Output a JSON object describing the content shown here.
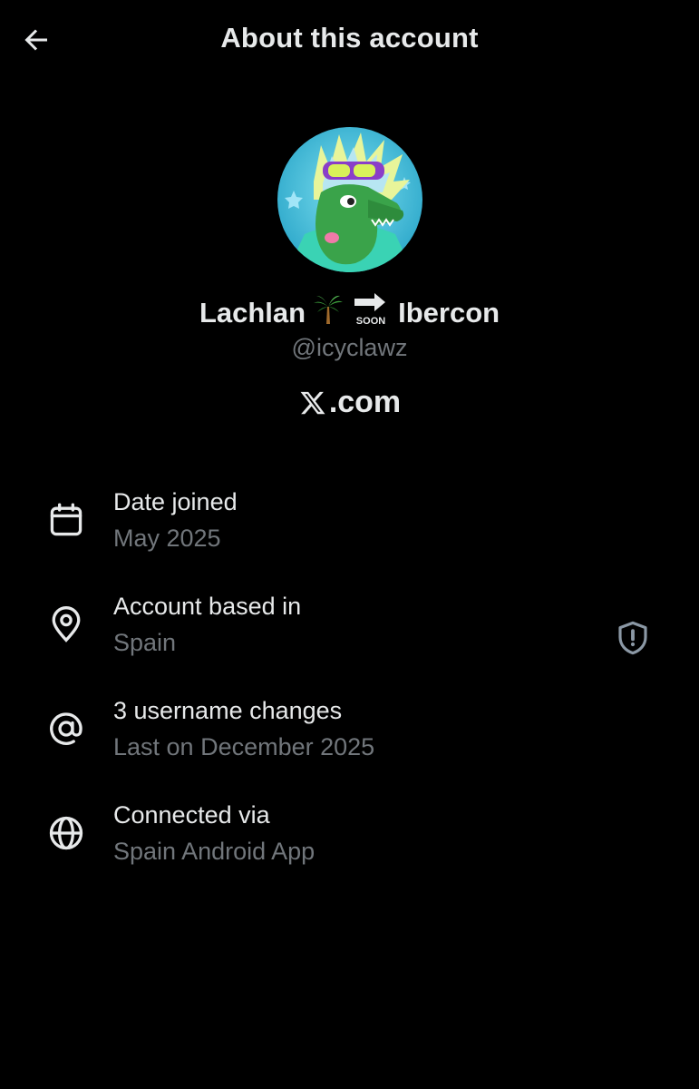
{
  "header": {
    "title": "About this account"
  },
  "profile": {
    "name_first": "Lachlan",
    "soon_label": "SOON",
    "name_last": "Ibercon",
    "handle": "@icyclawz",
    "site_suffix": ".com"
  },
  "info": [
    {
      "icon": "calendar-icon",
      "title": "Date joined",
      "subtitle": "May 2025"
    },
    {
      "icon": "location-pin-icon",
      "title": "Account based in",
      "subtitle": "Spain"
    },
    {
      "icon": "at-sign-icon",
      "title": "3 username changes",
      "subtitle": "Last on December 2025"
    },
    {
      "icon": "globe-icon",
      "title": "Connected via",
      "subtitle": "Spain Android App"
    }
  ],
  "colors": {
    "background": "#000000",
    "primary_text": "#e7e9ea",
    "secondary_text": "#71767b"
  }
}
